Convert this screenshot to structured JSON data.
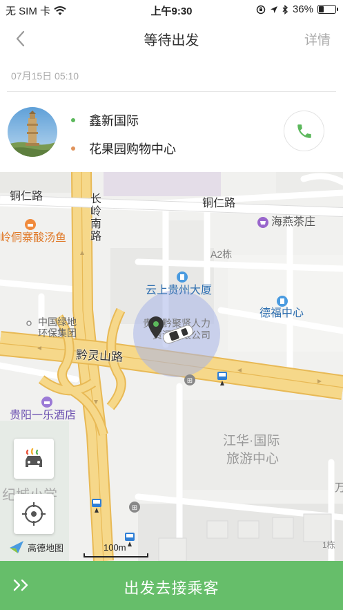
{
  "status_bar": {
    "carrier": "无 SIM 卡",
    "time": "上午9:30",
    "battery_percent": "36%",
    "battery_level": 0.36,
    "icons": [
      "wifi-icon",
      "orientation-lock-icon",
      "location-icon",
      "bluetooth-icon",
      "battery-icon"
    ]
  },
  "nav": {
    "back_icon": "chevron-left-icon",
    "title": "等待出发",
    "detail_label": "详情"
  },
  "order": {
    "datetime": "07月15日 05:10",
    "start": "鑫新国际",
    "end": "花果园购物中心",
    "start_dot_color": "#5cb85c",
    "end_dot_color": "#e0935b",
    "call_icon": "phone-icon"
  },
  "map": {
    "roads": [
      "铜仁路",
      "铜仁路",
      "长岭南路",
      "黔灵山路"
    ],
    "pois": [
      "岭侗寨酸汤鱼",
      "海燕茶庄",
      "A2栋",
      "云上贵州大厦",
      "德福中心",
      "中国绿地",
      "环保集团",
      "贵州黔聚贤人力",
      "资源有限公司",
      "贵阳一乐酒店",
      "江华·国际",
      "旅游中心",
      "纪城小学",
      "1栋",
      "万"
    ],
    "provider": "高德地图",
    "scale_label": "100m",
    "buttons": [
      "car-mode-button",
      "locate-button"
    ]
  },
  "action": {
    "label": "出发去接乘客",
    "arrows_icon": "double-chevron-right-icon"
  },
  "colors": {
    "accent": "#66be6a",
    "road_main": "#f6d88a",
    "road_edge": "#e8b955",
    "map_bg": "#f1f1ef"
  }
}
